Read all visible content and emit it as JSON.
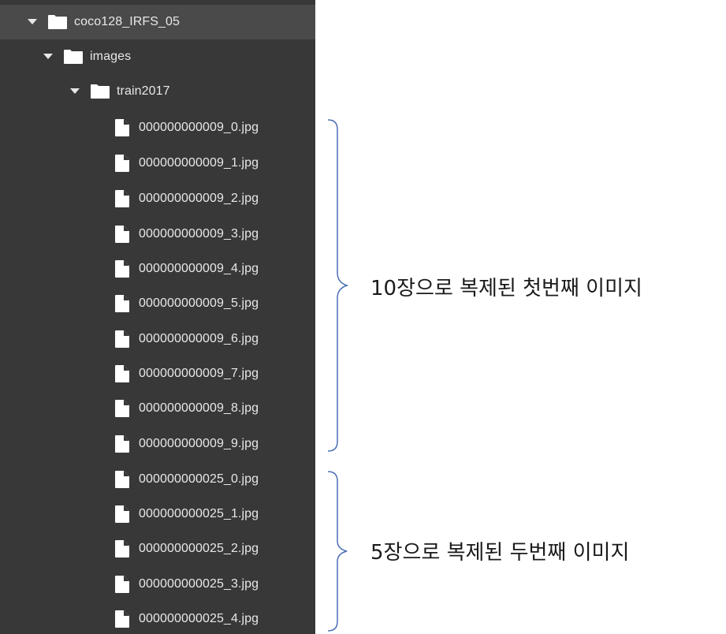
{
  "tree": {
    "root": {
      "label": "coco128_IRFS_05",
      "expanded": true,
      "icon": "folder-icon"
    },
    "images": {
      "label": "images",
      "expanded": true,
      "icon": "folder-icon"
    },
    "train": {
      "label": "train2017",
      "expanded": true,
      "icon": "folder-icon"
    },
    "files": [
      {
        "label": "000000000009_0.jpg"
      },
      {
        "label": "000000000009_1.jpg"
      },
      {
        "label": "000000000009_2.jpg"
      },
      {
        "label": "000000000009_3.jpg"
      },
      {
        "label": "000000000009_4.jpg"
      },
      {
        "label": "000000000009_5.jpg"
      },
      {
        "label": "000000000009_6.jpg"
      },
      {
        "label": "000000000009_7.jpg"
      },
      {
        "label": "000000000009_8.jpg"
      },
      {
        "label": "000000000009_9.jpg"
      },
      {
        "label": "000000000025_0.jpg"
      },
      {
        "label": "000000000025_1.jpg"
      },
      {
        "label": "000000000025_2.jpg"
      },
      {
        "label": "000000000025_3.jpg"
      },
      {
        "label": "000000000025_4.jpg"
      }
    ]
  },
  "annotations": {
    "first": "10장으로 복제된 첫번째 이미지",
    "second": "5장으로 복제된 두번째 이미지"
  },
  "colors": {
    "panel_bg": "#383838",
    "selected_bg": "#4a4a4a",
    "text": "#e8e8e8",
    "icon": "#ffffff",
    "brace": "#4a6fb5"
  }
}
